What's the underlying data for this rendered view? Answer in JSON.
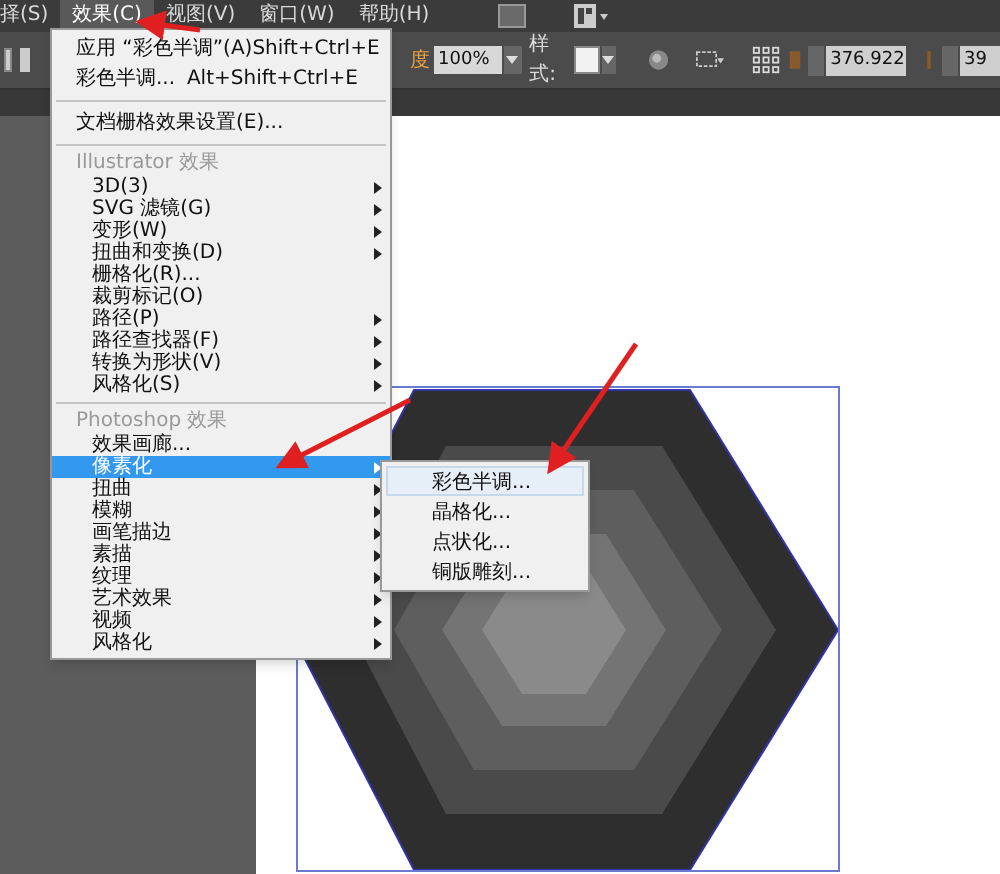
{
  "menu_bar": [
    {
      "label": "择(S)",
      "selected": false
    },
    {
      "label": "效果(C)",
      "selected": true
    },
    {
      "label": "视图(V)",
      "selected": false
    },
    {
      "label": "窗口(W)",
      "selected": false
    },
    {
      "label": "帮助(H)",
      "selected": false
    }
  ],
  "toolbar": {
    "opacity_label": "度",
    "opacity_value": "100%",
    "style_label": "样式:",
    "x_value": "376.922",
    "y_value": "39"
  },
  "effect_menu": [
    {
      "kind": "command",
      "label": "应用 “彩色半调”(A)",
      "shortcut": "Shift+Ctrl+E"
    },
    {
      "kind": "command",
      "label": "彩色半调...",
      "shortcut": "Alt+Shift+Ctrl+E"
    },
    {
      "kind": "separator"
    },
    {
      "kind": "command",
      "label": "文档栅格效果设置(E)..."
    },
    {
      "kind": "separator"
    },
    {
      "kind": "header",
      "label": "Illustrator 效果"
    },
    {
      "kind": "item",
      "label": "3D(3)",
      "submenu": true,
      "selected": false
    },
    {
      "kind": "item",
      "label": "SVG 滤镜(G)",
      "submenu": true,
      "selected": false
    },
    {
      "kind": "item",
      "label": "变形(W)",
      "submenu": true,
      "selected": false
    },
    {
      "kind": "item",
      "label": "扭曲和变换(D)",
      "submenu": true,
      "selected": false
    },
    {
      "kind": "item",
      "label": "栅格化(R)...",
      "submenu": false,
      "selected": false
    },
    {
      "kind": "item",
      "label": "裁剪标记(O)",
      "submenu": false,
      "selected": false
    },
    {
      "kind": "item",
      "label": "路径(P)",
      "submenu": true,
      "selected": false
    },
    {
      "kind": "item",
      "label": "路径查找器(F)",
      "submenu": true,
      "selected": false
    },
    {
      "kind": "item",
      "label": "转换为形状(V)",
      "submenu": true,
      "selected": false
    },
    {
      "kind": "item",
      "label": "风格化(S)",
      "submenu": true,
      "selected": false
    },
    {
      "kind": "separator"
    },
    {
      "kind": "header",
      "label": "Photoshop 效果"
    },
    {
      "kind": "item",
      "label": "效果画廊...",
      "submenu": false,
      "selected": false
    },
    {
      "kind": "item",
      "label": "像素化",
      "submenu": true,
      "selected": true
    },
    {
      "kind": "item",
      "label": "扭曲",
      "submenu": true,
      "selected": false
    },
    {
      "kind": "item",
      "label": "模糊",
      "submenu": true,
      "selected": false
    },
    {
      "kind": "item",
      "label": "画笔描边",
      "submenu": true,
      "selected": false
    },
    {
      "kind": "item",
      "label": "素描",
      "submenu": true,
      "selected": false
    },
    {
      "kind": "item",
      "label": "纹理",
      "submenu": true,
      "selected": false
    },
    {
      "kind": "item",
      "label": "艺术效果",
      "submenu": true,
      "selected": false
    },
    {
      "kind": "item",
      "label": "视频",
      "submenu": true,
      "selected": false
    },
    {
      "kind": "item",
      "label": "风格化",
      "submenu": true,
      "selected": false
    }
  ],
  "submenu": [
    {
      "label": "彩色半调...",
      "selected": true
    },
    {
      "label": "晶格化...",
      "selected": false
    },
    {
      "label": "点状化...",
      "selected": false
    },
    {
      "label": "铜版雕刻...",
      "selected": false
    }
  ]
}
